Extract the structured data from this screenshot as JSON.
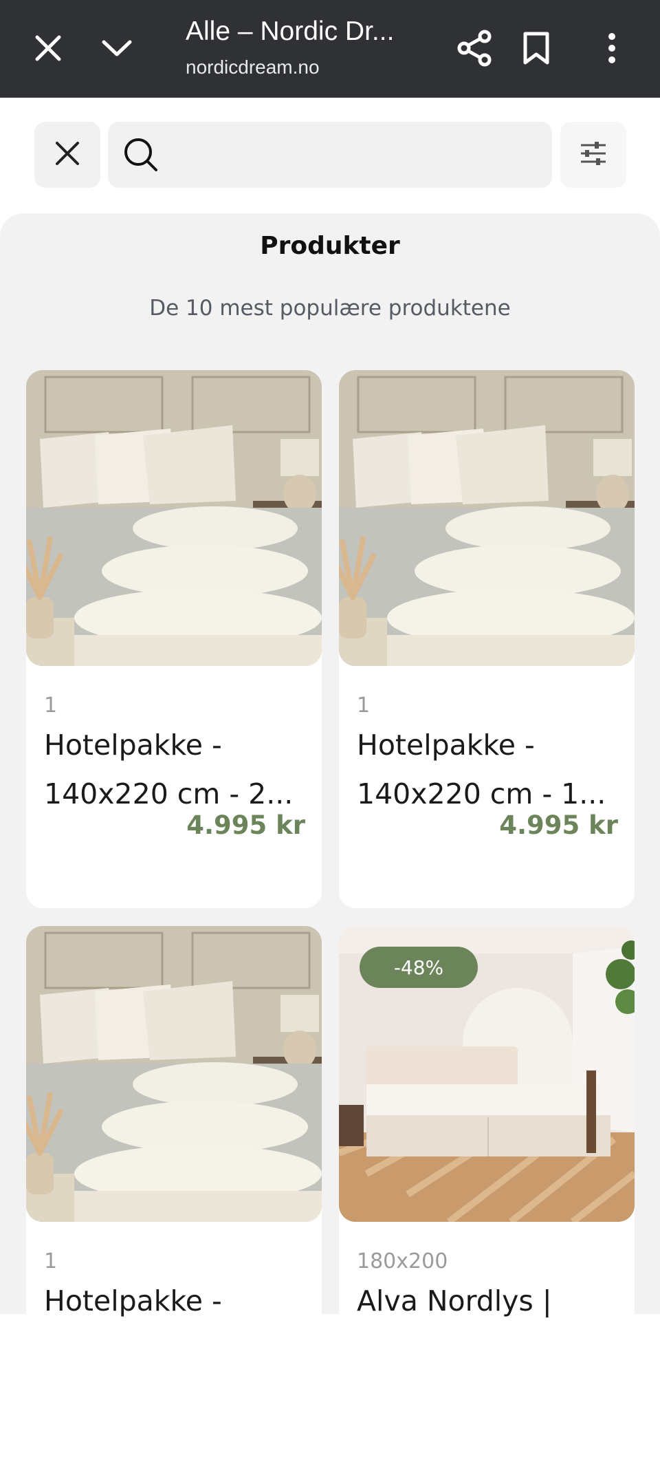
{
  "browser": {
    "title": "Alle – Nordic Dr...",
    "url": "nordicdream.no",
    "icons": [
      "close-icon",
      "chevron-down-icon",
      "share-icon",
      "bookmark-icon",
      "more-vert-icon"
    ]
  },
  "search": {
    "value": "",
    "placeholder": "",
    "icons": [
      "close-icon",
      "search-icon",
      "filter-sliders-icon"
    ]
  },
  "products_panel": {
    "title": "Produkter",
    "subtitle": "De 10 mest populære produktene"
  },
  "products": [
    {
      "meta": "1",
      "name_line1": "Hotelpakke -",
      "name_line2": "140x220 cm - 2...",
      "price": "4.995 kr",
      "image": "pillows-duvets-photo"
    },
    {
      "meta": "1",
      "name_line1": "Hotelpakke -",
      "name_line2": "140x220 cm - 1...",
      "price": "4.995 kr",
      "image": "pillows-duvets-photo"
    },
    {
      "meta": "1",
      "name_line1": "Hotelpakke -",
      "name_line2": "",
      "price": "",
      "image": "pillows-duvets-photo"
    },
    {
      "meta": "180x200",
      "name_line1": "Alva Nordlys |",
      "name_line2": "",
      "price": "",
      "badge": "-48%",
      "image": "bed-room-photo"
    }
  ],
  "colors": {
    "topbar": "#303134",
    "accent": "#6c845a",
    "panel": "#f2f2f2"
  }
}
